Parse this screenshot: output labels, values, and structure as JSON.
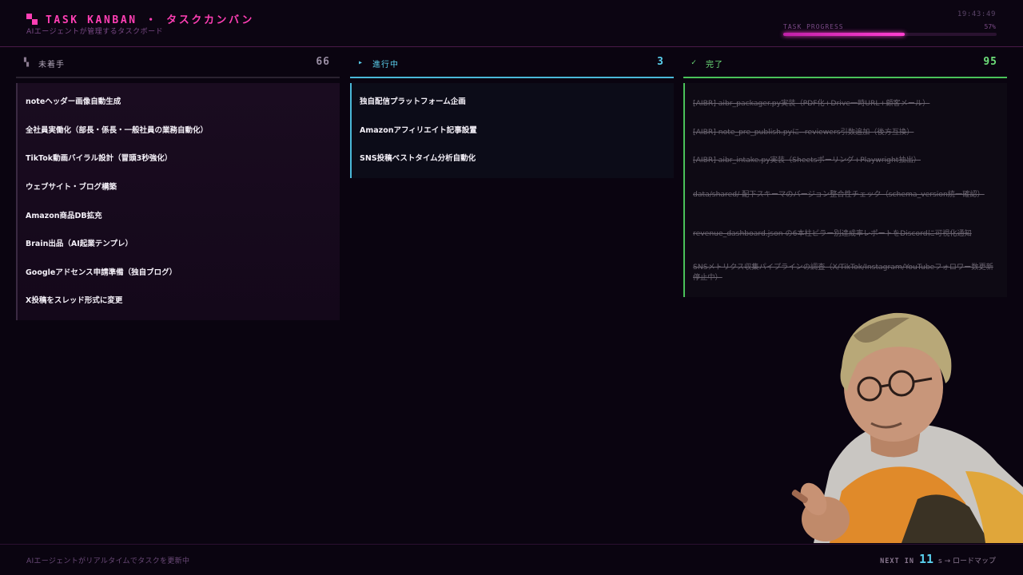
{
  "header": {
    "title": "TASK KANBAN ・ タスクカンバン",
    "subtitle": "AIエージェントが管理するタスクボード",
    "clock": "19:43:49",
    "progress_label": "TASK PROGRESS",
    "progress_percent_text": "57%",
    "progress_value": 0.57
  },
  "columns": {
    "todo": {
      "icon": "pixel-blocks-icon",
      "title": "未着手",
      "count": "66",
      "cards": [
        "noteヘッダー画像自動生成",
        "全社員実働化（部長・係長・一般社員の業務自動化）",
        "TikTok動画バイラル設計（冒頭3秒強化）",
        "ウェブサイト・ブログ構築",
        "Amazon商品DB拡充",
        "Brain出品（AI起業テンプレ）",
        "Googleアドセンス申請準備（独自ブログ）",
        "X投稿をスレッド形式に変更"
      ]
    },
    "doing": {
      "icon": "play-triangle-icon",
      "icon_glyph": "▸",
      "title": "進行中",
      "count": "3",
      "cards": [
        "独自配信プラットフォーム企画",
        "Amazonアフィリエイト記事設置",
        "SNS投稿ベストタイム分析自動化"
      ]
    },
    "done": {
      "icon": "checkmark-icon",
      "icon_glyph": "✓",
      "title": "完了",
      "count": "95",
      "cards": [
        "[AIBR] aibr_packager.py実装（PDF化+Drive一時URL+顧客メール）",
        "[AIBR] note_pre_publish.pyに--reviewers引数追加（後方互換）",
        "[AIBR] aibr_intake.py実装（Sheetsポーリング+Playwright抽出）",
        "data/shared/ 配下スキーマのバージョン整合性チェック（schema_version統一確認）",
        "revenue_dashboard.json の6本柱ピラー別達成率レポートをDiscordに可視化通知",
        "SNSメトリクス収集パイプラインの調査（X/TikTok/Instagram/YouTubeフォロワー数更新停止中）"
      ]
    }
  },
  "footer": {
    "status": "AIエージェントがリアルタイムでタスクを更新中",
    "next_label": "NEXT IN",
    "next_seconds": "11",
    "next_unit": "s → ロードマップ"
  },
  "colors": {
    "accent_pink": "#ff3fb4",
    "doing_cyan": "#5ad0ee",
    "done_green": "#6ee07a",
    "background": "#0a0410"
  }
}
